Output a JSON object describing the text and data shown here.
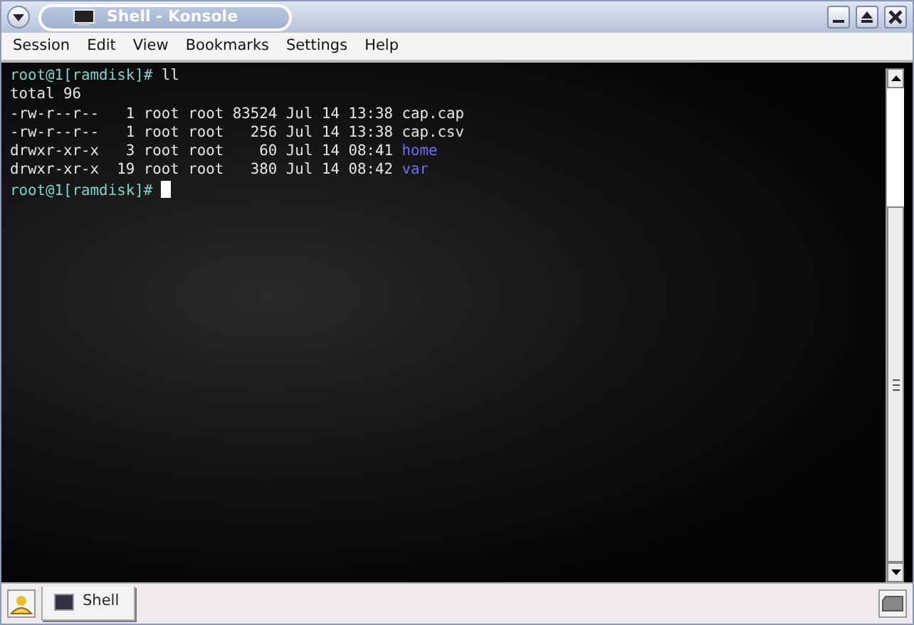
{
  "window": {
    "title": "Shell - Konsole"
  },
  "menu": [
    "Session",
    "Edit",
    "View",
    "Bookmarks",
    "Settings",
    "Help"
  ],
  "terminal": {
    "lines": [
      [
        {
          "kind": "prompt",
          "text": "root@1[ramdisk]#"
        },
        {
          "kind": "plain",
          "text": " ll"
        }
      ],
      [
        {
          "kind": "plain",
          "text": "total 96"
        }
      ],
      [
        {
          "kind": "plain",
          "text": "-rw-r--r--   1 root root 83524 Jul 14 13:38 cap.cap"
        }
      ],
      [
        {
          "kind": "plain",
          "text": "-rw-r--r--   1 root root   256 Jul 14 13:38 cap.csv"
        }
      ],
      [
        {
          "kind": "plain",
          "text": "drwxr-xr-x   3 root root    60 Jul 14 08:41 "
        },
        {
          "kind": "dir",
          "text": "home"
        }
      ],
      [
        {
          "kind": "plain",
          "text": "drwxr-xr-x  19 root root   380 Jul 14 08:42 "
        },
        {
          "kind": "dir",
          "text": "var"
        }
      ],
      [
        {
          "kind": "prompt",
          "text": "root@1[ramdisk]#"
        },
        {
          "kind": "cursor"
        }
      ]
    ]
  },
  "tabs": [
    {
      "label": "Shell",
      "selected": true
    }
  ]
}
